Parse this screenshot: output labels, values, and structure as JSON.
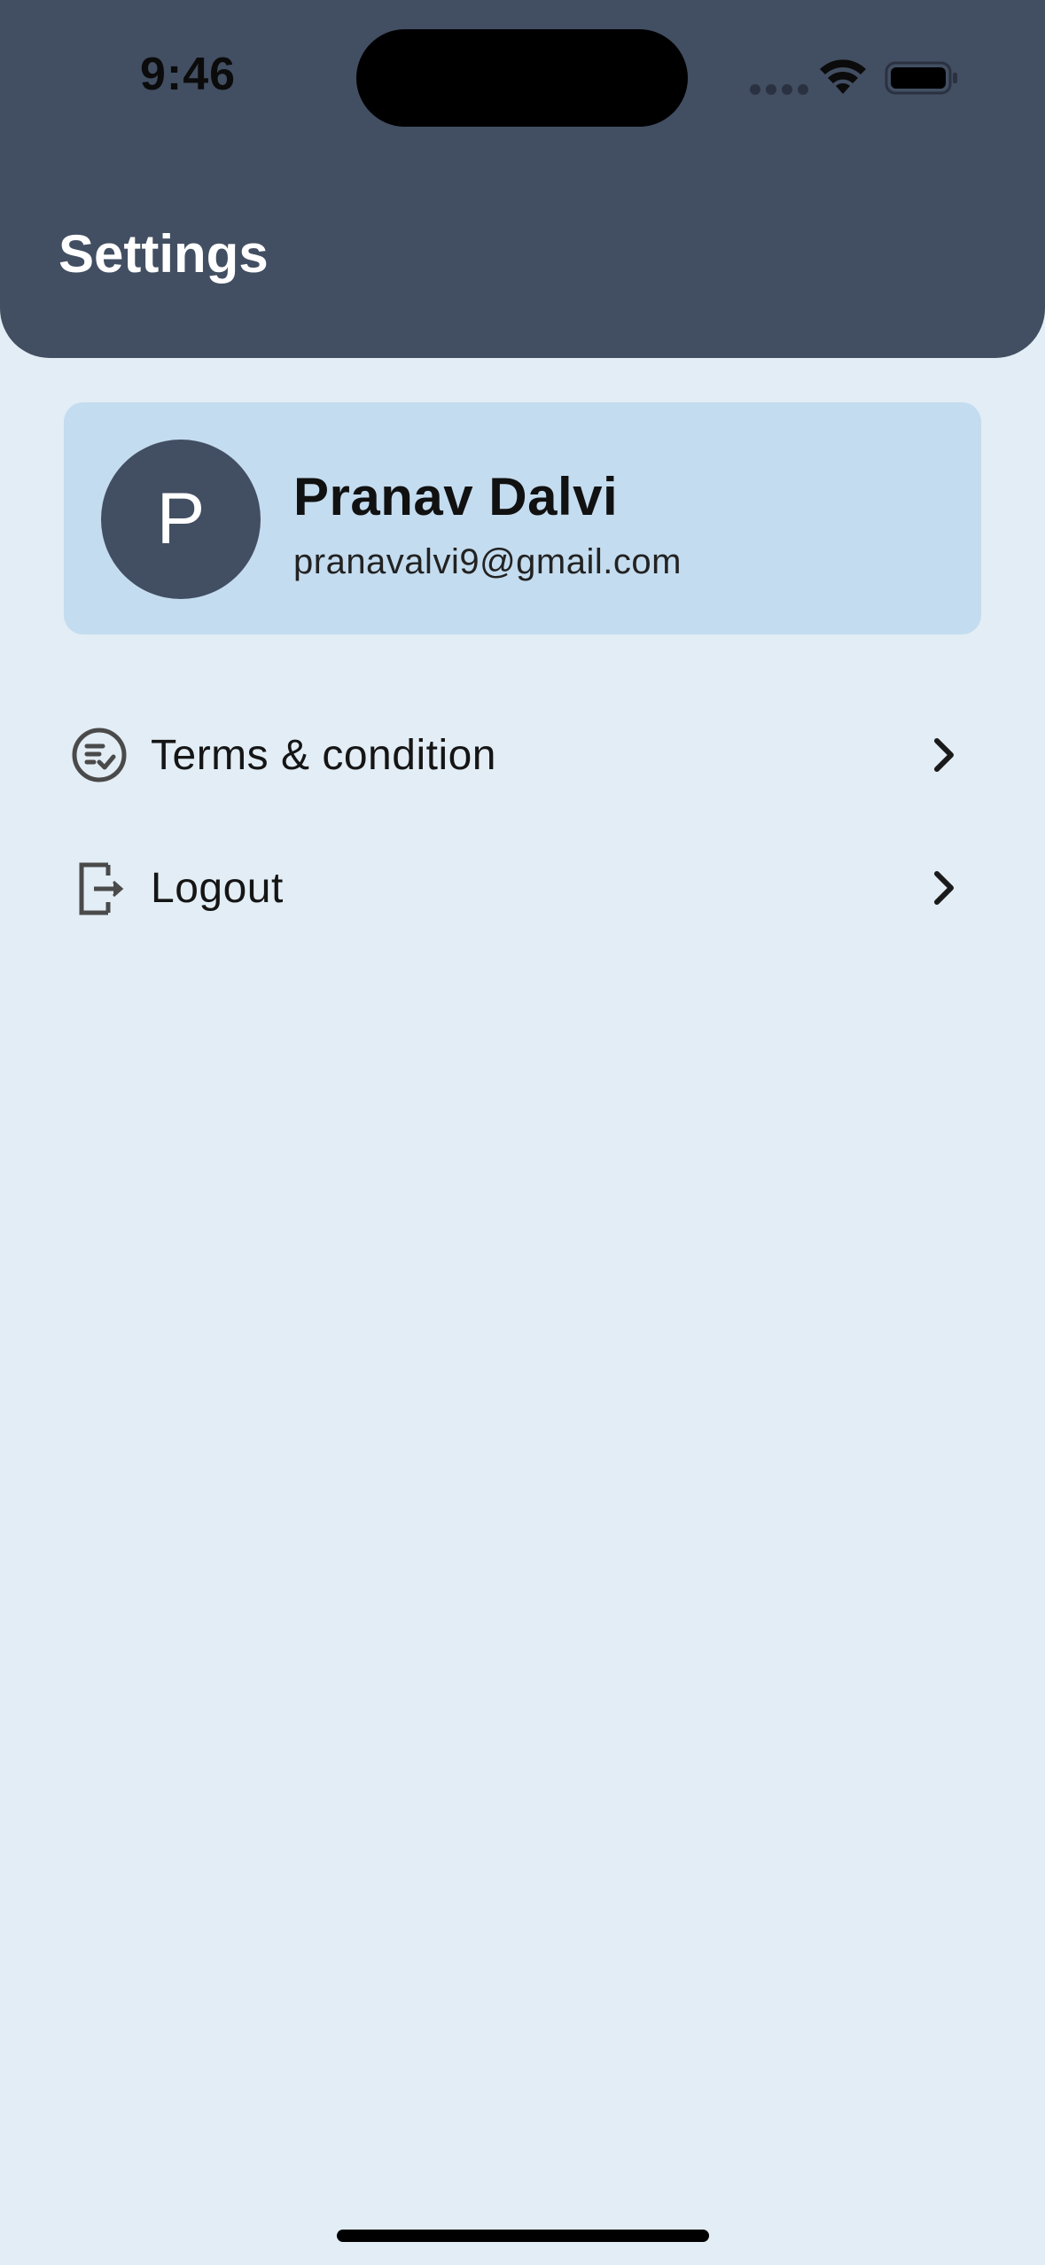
{
  "status_bar": {
    "time": "9:46",
    "icons": [
      "cellular-signal-icon",
      "wifi-icon",
      "battery-icon"
    ]
  },
  "header": {
    "title": "Settings",
    "background": "#424e62"
  },
  "profile": {
    "avatar_initial": "P",
    "name": "Pranav Dalvi",
    "email": "pranavalvi9@gmail.com",
    "card_color": "#c4dcef"
  },
  "menu": {
    "items": [
      {
        "label": "Terms & condition",
        "icon": "terms-checklist-icon"
      },
      {
        "label": "Logout",
        "icon": "logout-icon"
      }
    ]
  },
  "colors": {
    "background": "#e2edf5",
    "accent": "#424e62"
  }
}
